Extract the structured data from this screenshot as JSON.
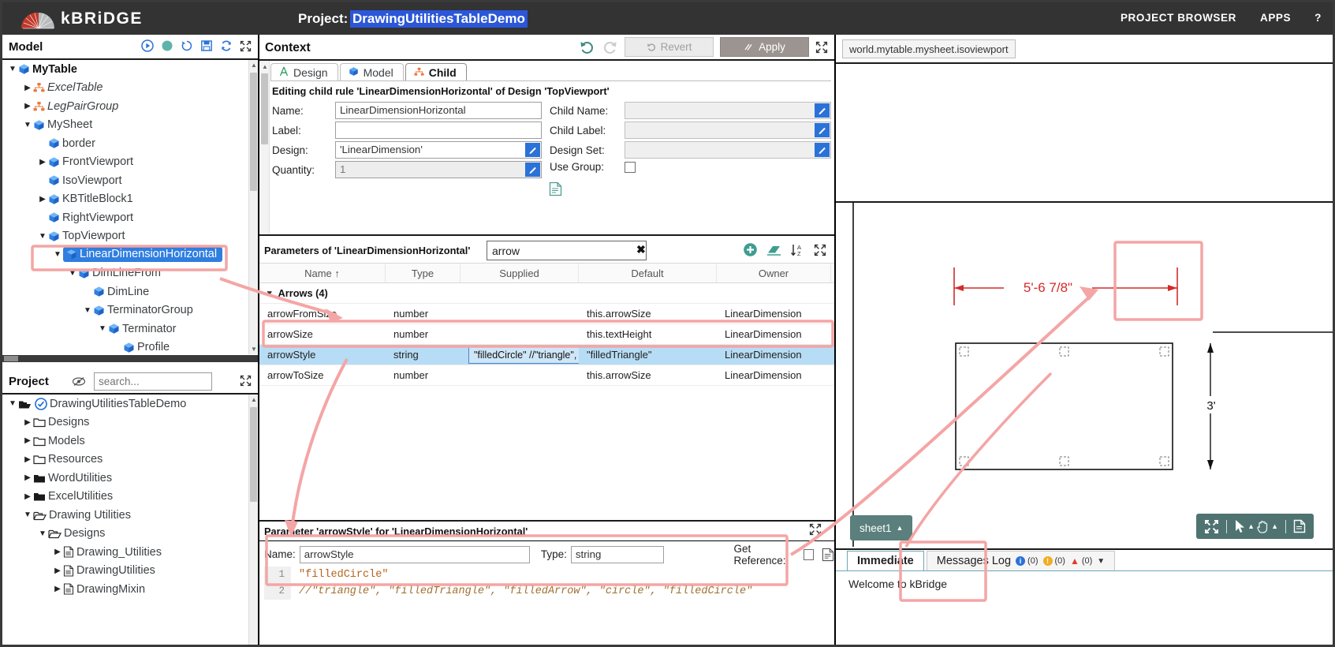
{
  "header": {
    "brand": "kBRiDGE",
    "project_label": "Project:",
    "project_name": "DrawingUtilitiesTableDemo",
    "links": [
      "PROJECT BROWSER",
      "APPS",
      "?"
    ]
  },
  "model_panel": {
    "title": "Model",
    "icons": [
      "play-icon",
      "record-icon",
      "history-icon",
      "save-icon",
      "refresh-icon",
      "expand-icon"
    ],
    "tree": [
      {
        "label": "MyTable",
        "depth": 0,
        "caret": "down",
        "icon": "cube-icon",
        "style": "bold"
      },
      {
        "label": "ExcelTable",
        "depth": 1,
        "caret": "right",
        "icon": "org-icon",
        "style": "italic"
      },
      {
        "label": "LegPairGroup",
        "depth": 1,
        "caret": "right",
        "icon": "org-icon",
        "style": "italic"
      },
      {
        "label": "MySheet",
        "depth": 1,
        "caret": "down",
        "icon": "cube-icon",
        "style": "normal"
      },
      {
        "label": "border",
        "depth": 2,
        "caret": "none",
        "icon": "cube-icon",
        "style": "normal"
      },
      {
        "label": "FrontViewport",
        "depth": 2,
        "caret": "right",
        "icon": "cube-icon",
        "style": "normal"
      },
      {
        "label": "IsoViewport",
        "depth": 2,
        "caret": "none",
        "icon": "cube-icon",
        "style": "normal"
      },
      {
        "label": "KBTitleBlock1",
        "depth": 2,
        "caret": "right",
        "icon": "cube-icon",
        "style": "normal"
      },
      {
        "label": "RightViewport",
        "depth": 2,
        "caret": "none",
        "icon": "cube-icon",
        "style": "normal"
      },
      {
        "label": "TopViewport",
        "depth": 2,
        "caret": "down",
        "icon": "cube-icon",
        "style": "normal"
      },
      {
        "label": "LinearDimensionHorizontal",
        "depth": 3,
        "caret": "down",
        "icon": "cube-icon",
        "style": "selected"
      },
      {
        "label": "DimLineFrom",
        "depth": 4,
        "caret": "down",
        "icon": "cube-icon",
        "style": "normal"
      },
      {
        "label": "DimLine",
        "depth": 5,
        "caret": "none",
        "icon": "cube-icon",
        "style": "normal"
      },
      {
        "label": "TerminatorGroup",
        "depth": 5,
        "caret": "down",
        "icon": "cube-icon",
        "style": "normal"
      },
      {
        "label": "Terminator",
        "depth": 6,
        "caret": "down",
        "icon": "cube-icon",
        "style": "normal"
      },
      {
        "label": "Profile",
        "depth": 7,
        "caret": "none",
        "icon": "cube-icon",
        "style": "normal"
      }
    ]
  },
  "project_panel": {
    "title": "Project",
    "search_placeholder": "search...",
    "tree": [
      {
        "label": "DrawingUtilitiesTableDemo",
        "depth": 0,
        "caret": "down",
        "icon": "open-folder-check-icon"
      },
      {
        "label": "Designs",
        "depth": 1,
        "caret": "right",
        "icon": "folder-icon"
      },
      {
        "label": "Models",
        "depth": 1,
        "caret": "right",
        "icon": "folder-icon"
      },
      {
        "label": "Resources",
        "depth": 1,
        "caret": "right",
        "icon": "folder-icon"
      },
      {
        "label": "WordUtilities",
        "depth": 1,
        "caret": "right",
        "icon": "folder-filled-icon"
      },
      {
        "label": "ExcelUtilities",
        "depth": 1,
        "caret": "right",
        "icon": "folder-filled-icon"
      },
      {
        "label": "Drawing Utilities",
        "depth": 1,
        "caret": "down",
        "icon": "open-folder-icon"
      },
      {
        "label": "Designs",
        "depth": 2,
        "caret": "down",
        "icon": "open-folder-icon"
      },
      {
        "label": "Drawing_Utilities",
        "depth": 3,
        "caret": "right",
        "icon": "doc-icon"
      },
      {
        "label": "DrawingUtilities",
        "depth": 3,
        "caret": "right",
        "icon": "doc-icon"
      },
      {
        "label": "DrawingMixin",
        "depth": 3,
        "caret": "right",
        "icon": "doc-icon"
      }
    ]
  },
  "context": {
    "title": "Context",
    "undo_icon": "undo-icon",
    "redo_icon": "redo-icon",
    "revert_label": "Revert",
    "apply_label": "Apply",
    "expand_icon": "expand-icon",
    "tabs": [
      {
        "label": "Design",
        "icon": "design-a-icon",
        "active": false
      },
      {
        "label": "Model",
        "icon": "cube-icon",
        "active": false
      },
      {
        "label": "Child",
        "icon": "org-icon",
        "active": true
      }
    ],
    "edit_note": "Editing child rule 'LinearDimensionHorizontal' of Design 'TopViewport'",
    "fields": {
      "name_label": "Name:",
      "name_value": "LinearDimensionHorizontal",
      "label_label": "Label:",
      "label_value": "",
      "design_label": "Design:",
      "design_value": "'LinearDimension'",
      "quantity_label": "Quantity:",
      "quantity_value": "1",
      "child_name_label": "Child Name:",
      "child_name_value": "",
      "child_label_label": "Child Label:",
      "child_label_value": "",
      "design_set_label": "Design Set:",
      "design_set_value": "",
      "use_group_label": "Use Group:",
      "use_group_checked": false
    }
  },
  "params": {
    "title": "Parameters of 'LinearDimensionHorizontal'",
    "filter_value": "arrow",
    "clear_icon": "clear-x-icon",
    "icons": [
      "add-circle-icon",
      "erase-icon",
      "sort-az-icon",
      "expand-icon"
    ],
    "columns": [
      "Name ↑",
      "Type",
      "Supplied",
      "Default",
      "Owner"
    ],
    "group": "Arrows (4)",
    "rows": [
      {
        "name": "arrowFromSize",
        "type": "number",
        "supplied": "",
        "default": "this.arrowSize",
        "owner": "LinearDimension",
        "selected": false
      },
      {
        "name": "arrowSize",
        "type": "number",
        "supplied": "",
        "default": "this.textHeight",
        "owner": "LinearDimension",
        "selected": false
      },
      {
        "name": "arrowStyle",
        "type": "string",
        "supplied": "\"filledCircle\" //\"triangle\", \"f...",
        "default": "\"filledTriangle\"",
        "owner": "LinearDimension",
        "selected": true
      },
      {
        "name": "arrowToSize",
        "type": "number",
        "supplied": "",
        "default": "this.arrowSize",
        "owner": "LinearDimension",
        "selected": false
      }
    ]
  },
  "param_editor": {
    "title": "Parameter 'arrowStyle' for 'LinearDimensionHorizontal'",
    "name_label": "Name:",
    "name_value": "arrowStyle",
    "type_label": "Type:",
    "type_value": "string",
    "get_reference_label": "Get Reference:",
    "get_reference_checked": false,
    "doc_icon": "document-icon",
    "expand_icon": "expand-icon",
    "code_lines": [
      {
        "num": "1",
        "text": "\"filledCircle\"",
        "comment": false
      },
      {
        "num": "2",
        "text": "//\"triangle\", \"filledTriangle\", \"filledArrow\", \"circle\", \"filledCircle\"",
        "comment": true
      }
    ]
  },
  "viewport": {
    "reference_chip": "world.mytable.mysheet.isoviewport",
    "sheet_tab": "sheet1",
    "tools": [
      "fit-icon",
      "select-arrow-icon",
      "pan-hand-icon",
      "pdf-icon"
    ],
    "drawing": {
      "dimension_horizontal": "5'-6 7/8\"",
      "dimension_vertical": "3'"
    }
  },
  "bottom_right": {
    "tabs": [
      {
        "label": "Immediate",
        "active": true
      },
      {
        "label": "Messages Log",
        "active": false
      }
    ],
    "counts": {
      "info": "(0)",
      "warn": "(0)",
      "error": "(0)"
    },
    "message": "Welcome to kBridge"
  },
  "colors": {
    "header_bg": "#333333",
    "accent_blue": "#2f7ee0",
    "selection_blue": "#2b57d8",
    "highlight_red": "#f4a5a5",
    "teal": "#5b7f7c",
    "dimension_red": "#d42a2a"
  }
}
